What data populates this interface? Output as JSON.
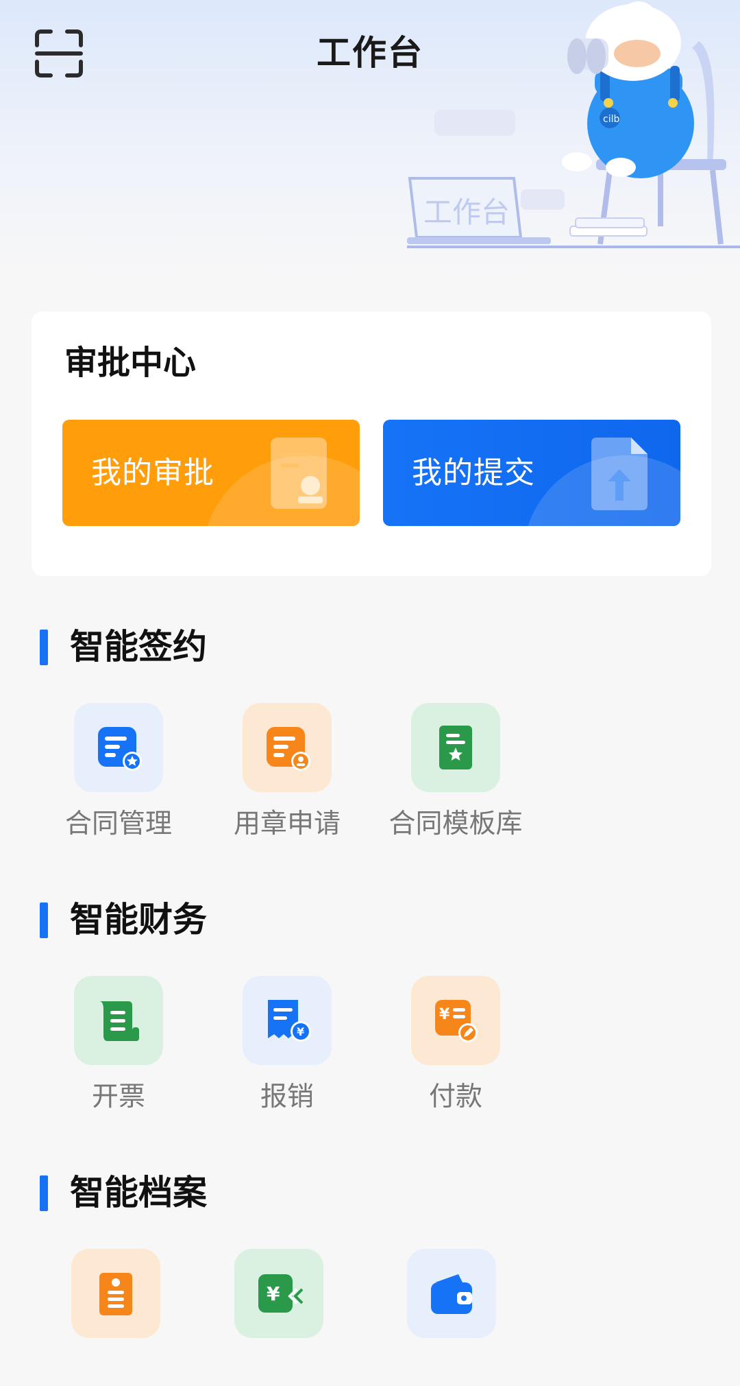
{
  "header": {
    "title": "工作台",
    "scan_icon": "scan-icon",
    "illustration_text": "工作台"
  },
  "approval_center": {
    "title": "审批中心",
    "my_approvals": {
      "label": "我的审批",
      "icon": "certificate-stamp-icon",
      "color": "#ff9d0b"
    },
    "my_submissions": {
      "label": "我的提交",
      "icon": "document-upload-icon",
      "color": "#1673f6"
    }
  },
  "sections": {
    "contracts": {
      "title": "智能签约",
      "items": [
        {
          "label": "合同管理",
          "icon": "contract-star-icon"
        },
        {
          "label": "用章申请",
          "icon": "seal-request-icon"
        },
        {
          "label": "合同模板库",
          "icon": "template-library-icon"
        }
      ]
    },
    "finance": {
      "title": "智能财务",
      "items": [
        {
          "label": "开票",
          "icon": "invoice-scroll-icon"
        },
        {
          "label": "报销",
          "icon": "reimbursement-icon"
        },
        {
          "label": "付款",
          "icon": "payment-icon"
        }
      ]
    },
    "archives": {
      "title": "智能档案",
      "items": [
        {
          "label": "",
          "icon": "archive-envelope-icon"
        },
        {
          "label": "",
          "icon": "yuan-transfer-icon"
        },
        {
          "label": "",
          "icon": "wallet-icon"
        }
      ]
    }
  },
  "colors": {
    "accent_blue": "#1673f6",
    "accent_orange": "#ff9d0b",
    "accent_green": "#2a9a4a"
  }
}
